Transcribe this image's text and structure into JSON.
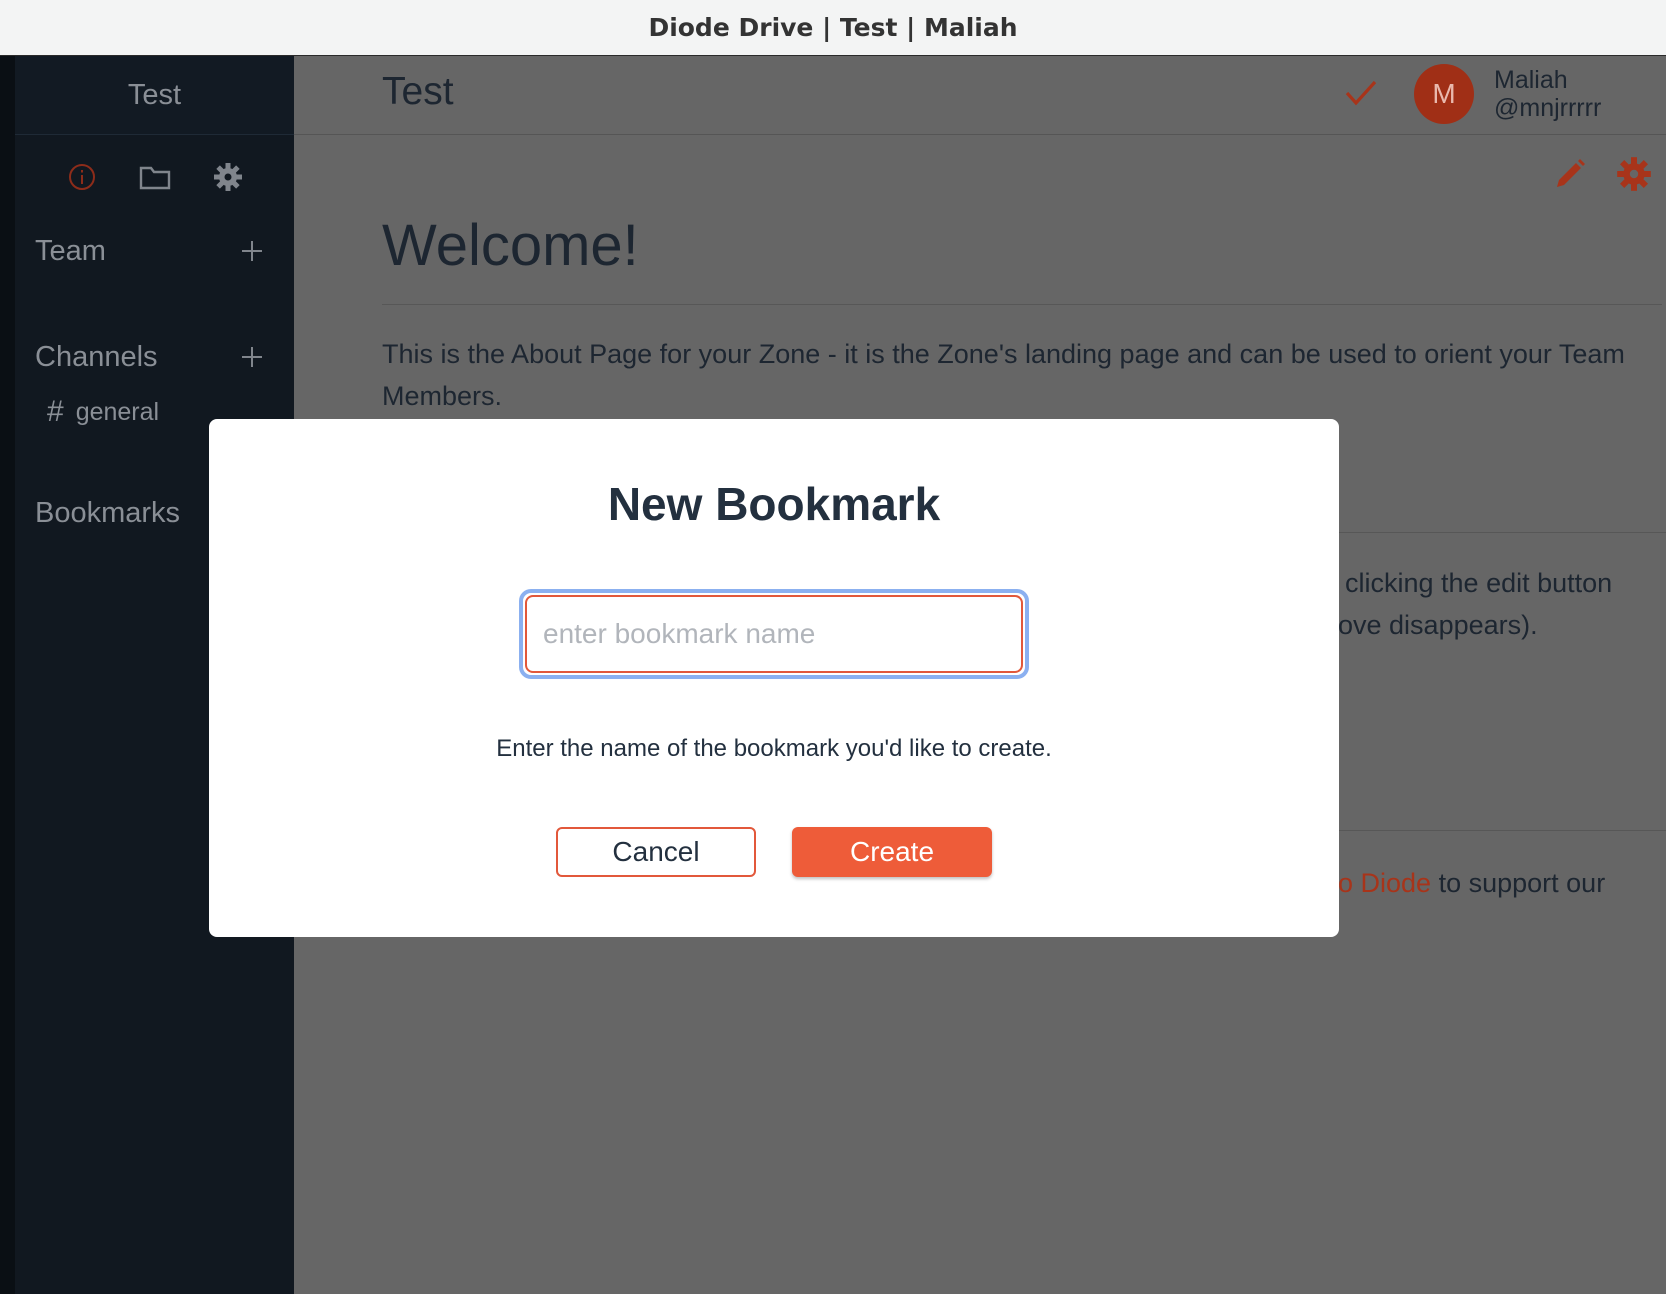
{
  "window": {
    "title": "Diode Drive | Test | Maliah"
  },
  "sidebar": {
    "zone_name": "Test",
    "icons": [
      "info-icon",
      "folder-icon",
      "gear-icon"
    ],
    "sections": {
      "team": {
        "label": "Team"
      },
      "channels": {
        "label": "Channels",
        "items": [
          {
            "name": "general"
          }
        ]
      },
      "bookmarks": {
        "label": "Bookmarks"
      }
    }
  },
  "header": {
    "title": "Test",
    "user": {
      "initial": "M",
      "name": "Maliah",
      "handle": "@mnjrrrrr"
    }
  },
  "content": {
    "heading": "Welcome!",
    "about": "This is the About Page for your Zone - it is the Zone's landing page and can be used to orient your Team Members.",
    "partial_line_1": "clicking the edit button",
    "partial_line_2": "ove disappears).",
    "partial_link": "o Diode",
    "partial_line_3_rest": " to support our"
  },
  "modal": {
    "title": "New Bookmark",
    "input_placeholder": "enter bookmark name",
    "input_value": "",
    "help_text": "Enter the name of the bookmark you'd like to create.",
    "cancel_label": "Cancel",
    "create_label": "Create"
  },
  "colors": {
    "accent": "#ee5c39",
    "sidebar_bg": "#111820",
    "overlay_bg": "#666666",
    "focus_ring": "#8bb0f0"
  }
}
